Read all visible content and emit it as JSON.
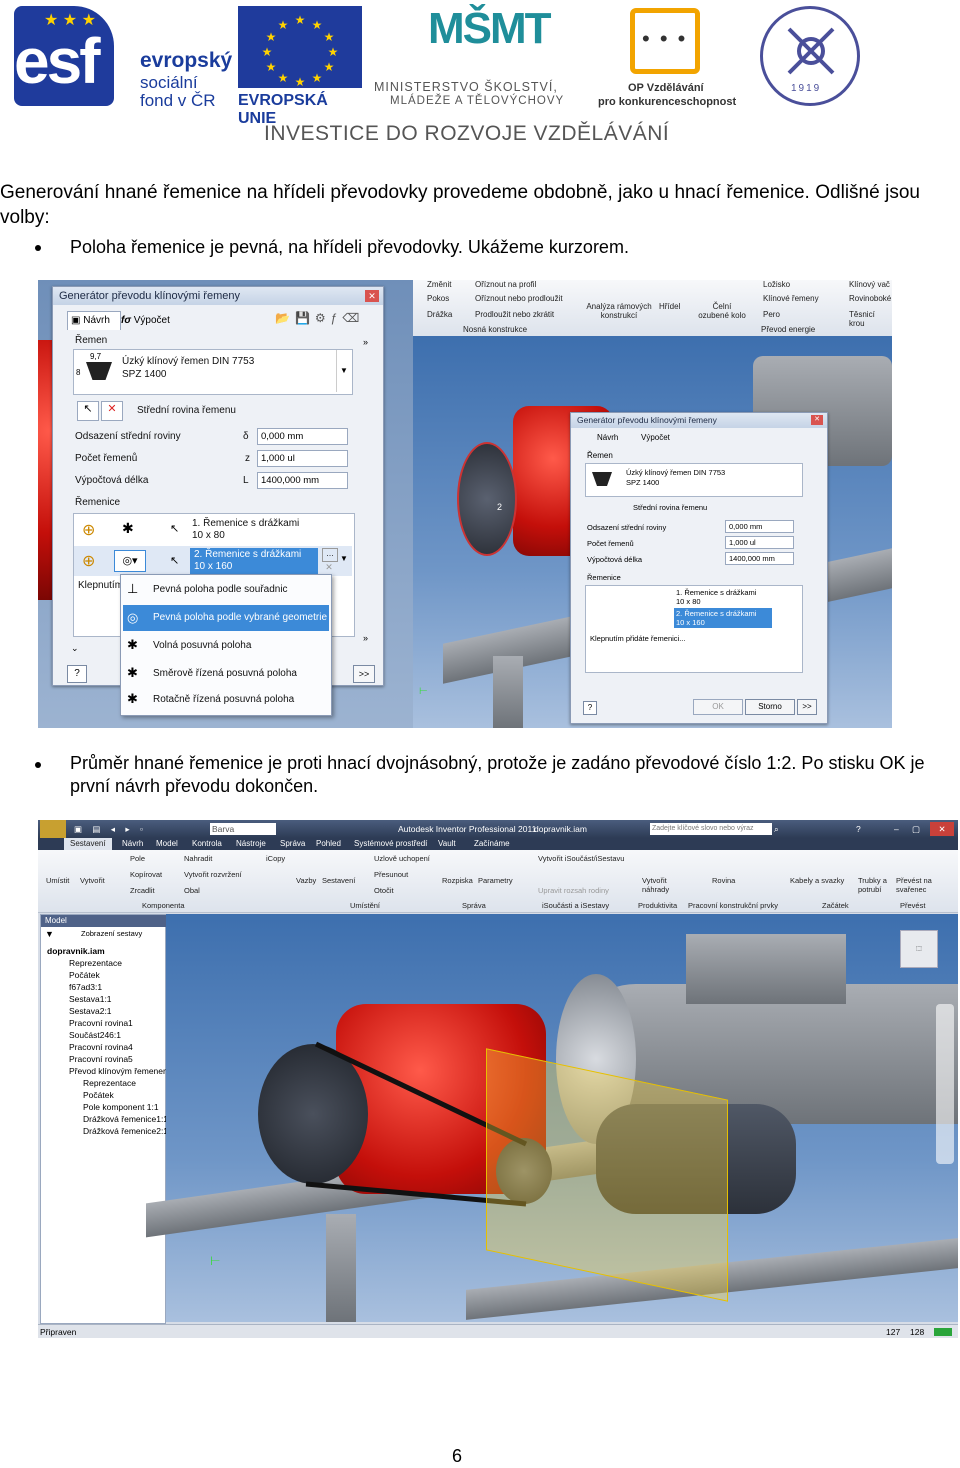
{
  "header": {
    "esf": {
      "big": "esf",
      "line1": "evropský",
      "line2": "sociální",
      "line3": "fond v ČR"
    },
    "eu": {
      "label": "EVROPSKÁ UNIE"
    },
    "msmt": {
      "letters": "MŠMT",
      "line1": "MINISTERSTVO ŠKOLSTVÍ,",
      "line2": "MLÁDEŽE A TĚLOVÝCHOVY"
    },
    "op": {
      "line1": "OP Vzdělávání",
      "line2": "pro konkurenceschopnost"
    },
    "seal_year": "1919",
    "tagline": "INVESTICE DO ROZVOJE VZDĚLÁVÁNÍ"
  },
  "content": {
    "intro": "Generování hnané řemenice na hřídeli převodovky provedeme obdobně, jako u hnací řemenice. Odlišné jsou volby:",
    "bullet1": "Poloha řemenice je pevná, na hřídeli převodovky. Ukážeme kurzorem.",
    "bullet2": "Průměr hnané řemenice je proti hnací dvojnásobný, protože je zadáno převodové číslo 1:2. Po stisku OK je první návrh převodu dokončen."
  },
  "screenshot1": {
    "dialog_title": "Generátor převodu klínovými řemeny",
    "tab_design": "Návrh",
    "tab_calc": "Výpočet",
    "belt_group": "Řemen",
    "belt_name": "Úzký klínový řemen DIN 7753",
    "belt_spec": "SPZ 1400",
    "belt_dim_top": "9,7",
    "belt_dim_side": "8",
    "mid_plane": "Střední rovina řemenu",
    "offset_label": "Odsazení střední roviny",
    "offset_sym": "δ",
    "offset_value": "0,000 mm",
    "count_label": "Počet řemenů",
    "count_sym": "z",
    "count_value": "1,000 ul",
    "length_label": "Výpočtová délka",
    "length_sym": "L",
    "length_value": "1400,000 mm",
    "pulleys_group": "Řemenice",
    "pulley1_name": "1. Řemenice s drážkami",
    "pulley1_dim": "10 x 80",
    "pulley2_name": "2. Řemenice s drážkami",
    "pulley2_dim": "10 x 160",
    "click_hint": "Klepnutím",
    "menu": [
      "Pevná poloha podle souřadnic",
      "Pevná poloha podle vybrané geometrie",
      "Volná posuvná poloha",
      "Směrově řízená posuvná poloha",
      "Rotačně řízená posuvná poloha"
    ],
    "ribbon_items": [
      "Změnit",
      "Oříznout na profil",
      "Pokos",
      "Oříznout nebo prodloužit",
      "Drážka",
      "Prodloužit nebo zkrátit",
      "Analýza rámových konstrukcí",
      "Hřídel",
      "Čelní ozubené kolo",
      "Ložisko",
      "Klínové řemeny",
      "Pero",
      "Klínový vač",
      "Rovinoboké",
      "Těsnicí krou"
    ],
    "ribbon_groups": [
      "Nosná konstrukce",
      "Převod energie"
    ],
    "small_dialog": {
      "title": "Generátor převodu klínovými řemeny",
      "click_hint": "Klepnutím přidáte řemenici...",
      "ok": "OK",
      "cancel": "Storno",
      "more": ">>"
    },
    "pulley_tag": "2"
  },
  "screenshot2": {
    "app_title": "Autodesk Inventor Professional 2011",
    "file": "dopravnik.iam",
    "search_placeholder": "Zadejte klíčové slovo nebo výraz",
    "style": "Barva",
    "tabs": [
      "Sestavení",
      "Návrh",
      "Model",
      "Kontrola",
      "Nástroje",
      "Správa",
      "Pohled",
      "Systémové prostředí",
      "Vault",
      "Začínáme"
    ],
    "ribbon": {
      "place": "Umístit",
      "create": "Vytvořit",
      "pattern": "Pole",
      "copy": "Kopírovat",
      "mirror": "Zrcadlit",
      "replace": "Nahradit",
      "create_replacement": "Vytvořit rozvržení",
      "shrinkwrap": "Obal",
      "icopy": "iCopy",
      "constraints": "Vazby",
      "assemble": "Sestavení",
      "grounded": "Uzlově uchopení",
      "move": "Přesunout",
      "rotate": "Otočit",
      "bom": "Rozpiska",
      "params": "Parametry",
      "ipart": "Vytvořit iSoučást/iSestavu",
      "edit_factory": "Upravit rozsah rodiny",
      "substitutes": "Vytvořit náhrady",
      "plane": "Rovina",
      "cables": "Kabely a svazky",
      "tubes": "Trubky a potrubí",
      "convert": "Převést na svařenec",
      "groups": [
        "Komponenta",
        "Umístění",
        "Správa",
        "iSoučásti a iSestavy",
        "Produktivita",
        "Pracovní konstrukční prvky",
        "Začátek",
        "Převést"
      ]
    },
    "browser_title": "Model",
    "browser_view": "Zobrazení sestavy",
    "tree": [
      "dopravnik.iam",
      "Reprezentace",
      "Počátek",
      "f67ad3:1",
      "Sestava1:1",
      "Sestava2:1",
      "Pracovní rovina1",
      "Součást246:1",
      "Pracovní rovina4",
      "Pracovní rovina5",
      "Převod klínovým řemenem:1",
      "Reprezentace",
      "Počátek",
      "Pole komponent 1:1",
      "Drážková řemenice1:1",
      "Drážková řemenice2:1"
    ],
    "status": "Připraven",
    "status_n1": "127",
    "status_n2": "128"
  },
  "page_number": "6"
}
